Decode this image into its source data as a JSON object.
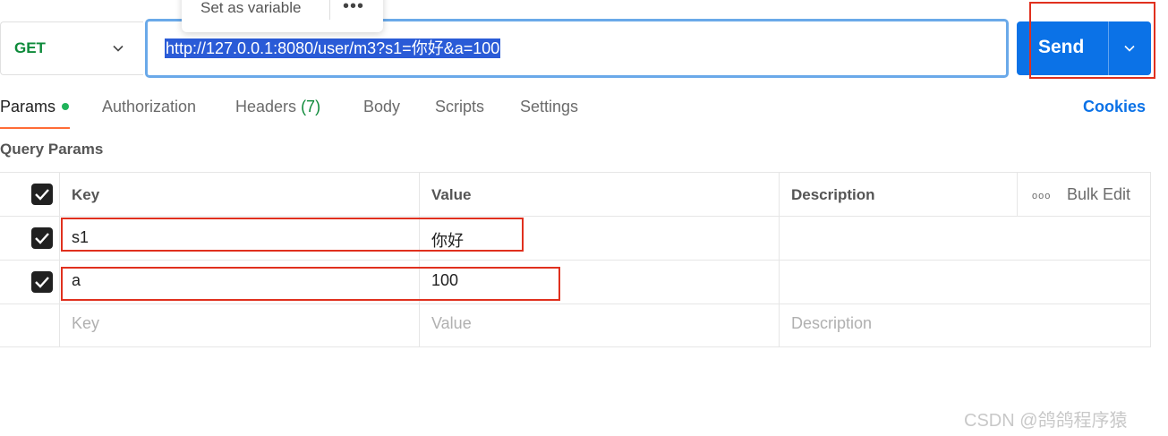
{
  "request": {
    "method": "GET",
    "url": "http://127.0.0.1:8080/user/m3?s1=你好&a=100",
    "tooltip_label": "Set as variable",
    "tooltip_more": "•••",
    "send_label": "Send"
  },
  "tabs": [
    {
      "label": "Params"
    },
    {
      "label": "Authorization"
    },
    {
      "label": "Headers",
      "count": "(7)"
    },
    {
      "label": "Body"
    },
    {
      "label": "Scripts"
    },
    {
      "label": "Settings"
    }
  ],
  "cookies_label": "Cookies",
  "section_title": "Query Params",
  "table": {
    "headers": {
      "key": "Key",
      "value": "Value",
      "description": "Description",
      "bulk_edit": "Bulk Edit",
      "bulk_dots": "ooo"
    },
    "rows": [
      {
        "key": "s1",
        "value": "你好",
        "checked": true
      },
      {
        "key": "a",
        "value": "100",
        "checked": true
      }
    ],
    "placeholders": {
      "key": "Key",
      "value": "Value",
      "description": "Description"
    }
  },
  "watermark": "CSDN @鸽鸽程序猿",
  "colors": {
    "accent": "#0b72e7",
    "method": "#0e8a3a",
    "highlight": "#e0301e",
    "tab_active": "#ff6c37"
  }
}
